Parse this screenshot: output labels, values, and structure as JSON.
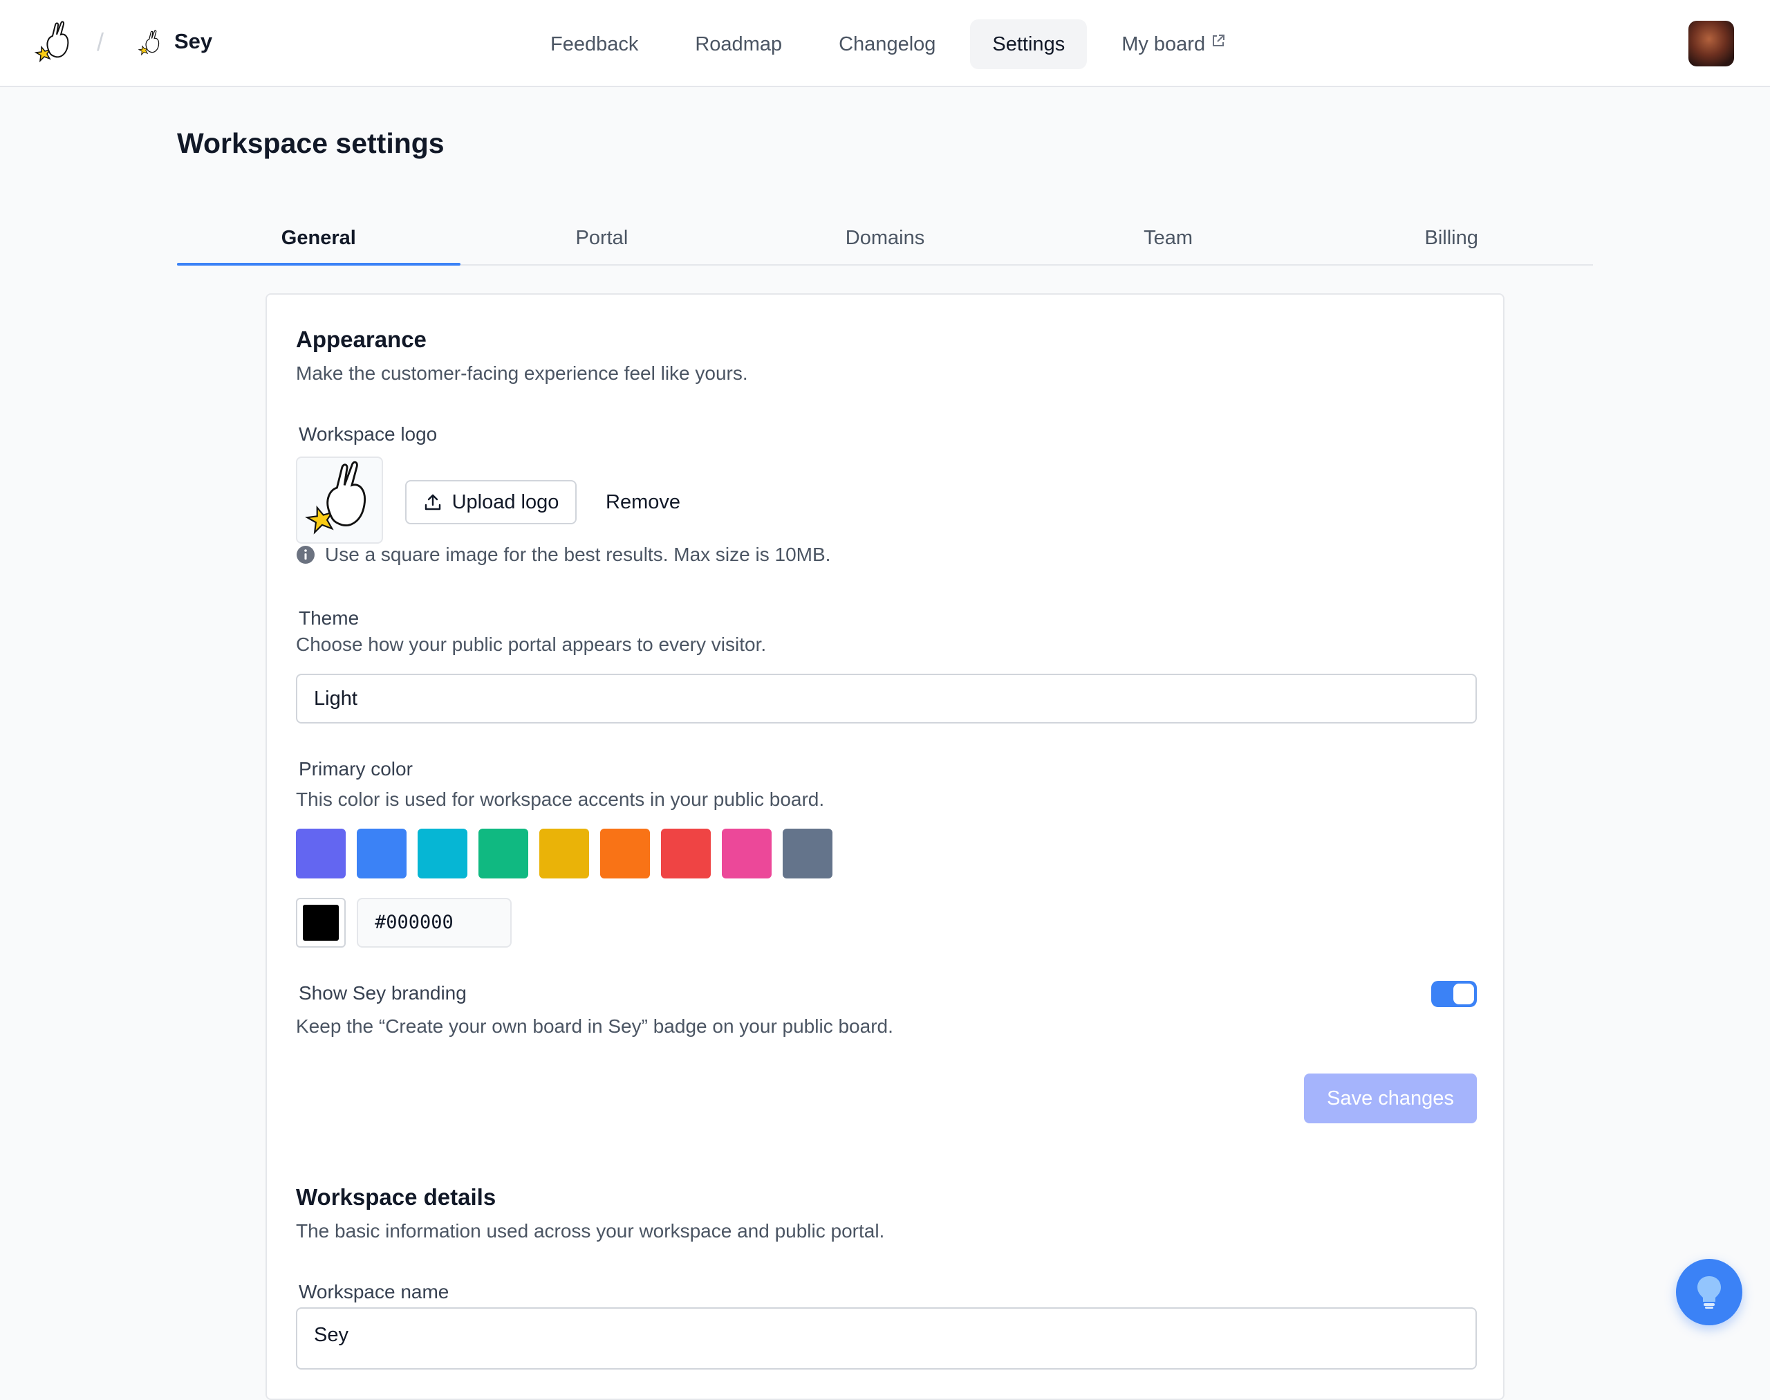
{
  "header": {
    "workspace_name": "Sey",
    "breadcrumb_separator": "/",
    "nav": [
      {
        "label": "Feedback",
        "active": false
      },
      {
        "label": "Roadmap",
        "active": false
      },
      {
        "label": "Changelog",
        "active": false
      },
      {
        "label": "Settings",
        "active": true
      },
      {
        "label": "My board",
        "active": false,
        "external": true
      }
    ]
  },
  "page": {
    "title": "Workspace settings",
    "tabs": [
      "General",
      "Portal",
      "Domains",
      "Team",
      "Billing"
    ],
    "active_tab": "General"
  },
  "appearance": {
    "title": "Appearance",
    "description": "Make the customer-facing experience feel like yours.",
    "logo_label": "Workspace logo",
    "upload_label": "Upload logo",
    "remove_label": "Remove",
    "logo_hint": "Use a square image for the best results. Max size is 10MB.",
    "theme_label": "Theme",
    "theme_description": "Choose how your public portal appears to every visitor.",
    "theme_value": "Light",
    "primary_color_label": "Primary color",
    "primary_color_description": "This color is used for workspace accents in your public board.",
    "swatches": [
      "#6366f1",
      "#3b82f6",
      "#06b6d4",
      "#10b981",
      "#eab308",
      "#f97316",
      "#ef4444",
      "#ec4899",
      "#64748b"
    ],
    "custom_color": "#000000",
    "branding_label": "Show Sey branding",
    "branding_description": "Keep the “Create your own board in Sey” badge on your public board.",
    "branding_enabled": true,
    "save_label": "Save changes"
  },
  "details": {
    "title": "Workspace details",
    "description": "The basic information used across your workspace and public portal.",
    "name_label": "Workspace name",
    "name_value": "Sey"
  },
  "icons": {
    "brand": "hand-star-logo-icon",
    "external": "external-link-icon",
    "upload": "upload-icon",
    "info": "info-icon",
    "help": "lightbulb-icon"
  }
}
